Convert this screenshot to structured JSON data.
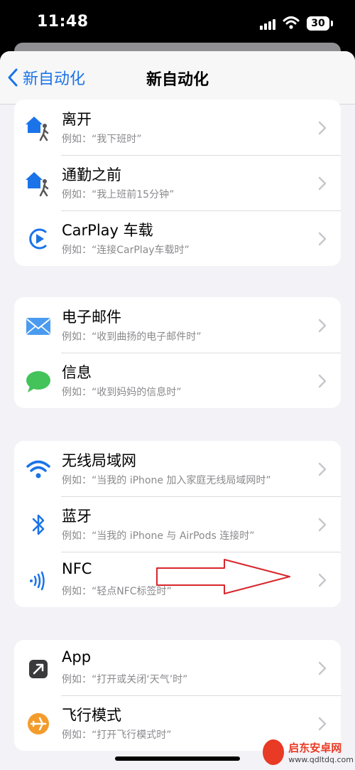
{
  "status_bar": {
    "time": "11:48",
    "battery_level": "30"
  },
  "navbar": {
    "back_label": "新自动化",
    "title": "新自动化"
  },
  "groups": [
    {
      "rows": [
        {
          "title": "离开",
          "subtitle": "例如：“我下班时”",
          "icon": "home-person-icon"
        },
        {
          "title": "通勤之前",
          "subtitle": "例如：“我上班前15分钟”",
          "icon": "home-person-icon"
        },
        {
          "title": "CarPlay 车载",
          "subtitle": "例如：“连接CarPlay车载时”",
          "icon": "carplay-icon"
        }
      ]
    },
    {
      "rows": [
        {
          "title": "电子邮件",
          "subtitle": "例如：“收到曲扬的电子邮件时”",
          "icon": "mail-icon"
        },
        {
          "title": "信息",
          "subtitle": "例如：“收到妈妈的信息时”",
          "icon": "message-icon"
        }
      ]
    },
    {
      "rows": [
        {
          "title": "无线局域网",
          "subtitle": "例如：“当我的 iPhone 加入家庭无线局域网时”",
          "icon": "wifi-icon"
        },
        {
          "title": "蓝牙",
          "subtitle": "例如：“当我的 iPhone 与 AirPods 连接时”",
          "icon": "bluetooth-icon"
        },
        {
          "title": "NFC",
          "subtitle": "例如：“轻点NFC标签时”",
          "icon": "nfc-icon"
        }
      ]
    },
    {
      "rows": [
        {
          "title": "App",
          "subtitle": "例如：“打开或关闭‘天气’时”",
          "icon": "app-icon"
        },
        {
          "title": "飞行模式",
          "subtitle": "例如：“打开飞行模式时”",
          "icon": "airplane-mode-icon"
        }
      ]
    }
  ],
  "watermark": {
    "title": "启东安卓网",
    "url": "www.qdltdq.com"
  },
  "colors": {
    "accent": "#1a73e8",
    "background": "#f2f2f7",
    "annotation_arrow": "#d8262c",
    "icon_orange": "#f39c2c",
    "icon_green": "#43c35a"
  }
}
